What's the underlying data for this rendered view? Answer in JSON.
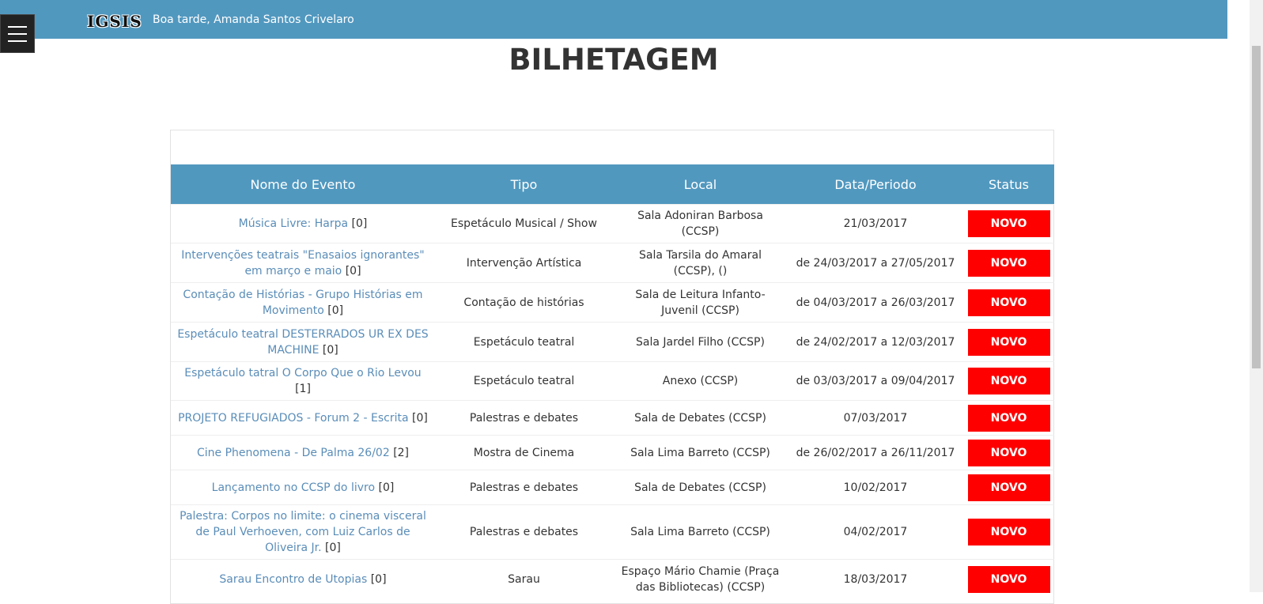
{
  "header": {
    "logo": "IGSIS",
    "greeting": "Boa tarde, Amanda Santos Crivelaro"
  },
  "page": {
    "title": "BILHETAGEM"
  },
  "table": {
    "columns": [
      "Nome do Evento",
      "Tipo",
      "Local",
      "Data/Periodo",
      "Status"
    ],
    "rows": [
      {
        "name": "Música Livre: Harpa",
        "count": "[0]",
        "tipo": "Espetáculo Musical / Show",
        "local": "Sala Adoniran Barbosa (CCSP)",
        "data": "21/03/2017",
        "status": "NOVO"
      },
      {
        "name": "Intervenções teatrais \"Enasaios ignorantes\" em março e maio",
        "count": "[0]",
        "tipo": "Intervenção Artística",
        "local": "Sala Tarsila do Amaral (CCSP), ()",
        "data": "de 24/03/2017 a 27/05/2017",
        "status": "NOVO"
      },
      {
        "name": "Contação de Histórias - Grupo Histórias em Movimento",
        "count": "[0]",
        "tipo": "Contação de histórias",
        "local": "Sala de Leitura Infanto-Juvenil (CCSP)",
        "data": "de 04/03/2017 a 26/03/2017",
        "status": "NOVO"
      },
      {
        "name": "Espetáculo teatral DESTERRADOS UR EX DES MACHINE",
        "count": "[0]",
        "tipo": "Espetáculo teatral",
        "local": "Sala Jardel Filho (CCSP)",
        "data": "de 24/02/2017 a 12/03/2017",
        "status": "NOVO"
      },
      {
        "name": "Espetáculo tatral O Corpo Que o Rio Levou",
        "count": "[1]",
        "tipo": "Espetáculo teatral",
        "local": "Anexo (CCSP)",
        "data": "de 03/03/2017 a 09/04/2017",
        "status": "NOVO"
      },
      {
        "name": "PROJETO REFUGIADOS - Forum 2 - Escrita",
        "count": "[0]",
        "tipo": "Palestras e debates",
        "local": "Sala de Debates (CCSP)",
        "data": "07/03/2017",
        "status": "NOVO"
      },
      {
        "name": "Cine Phenomena - De Palma 26/02",
        "count": "[2]",
        "tipo": "Mostra de Cinema",
        "local": "Sala Lima Barreto (CCSP)",
        "data": "de 26/02/2017 a 26/11/2017",
        "status": "NOVO"
      },
      {
        "name": "Lançamento no CCSP do livro",
        "count": "[0]",
        "tipo": "Palestras e debates",
        "local": "Sala de Debates (CCSP)",
        "data": "10/02/2017",
        "status": "NOVO"
      },
      {
        "name": "Palestra: Corpos no limite: o cinema visceral de Paul Verhoeven, com Luiz Carlos de Oliveira Jr.",
        "count": "[0]",
        "tipo": "Palestras e debates",
        "local": "Sala Lima Barreto (CCSP)",
        "data": "04/02/2017",
        "status": "NOVO"
      },
      {
        "name": "Sarau Encontro de Utopias",
        "count": "[0]",
        "tipo": "Sarau",
        "local": "Espaço Mário Chamie (Praça das Bibliotecas) (CCSP)",
        "data": "18/03/2017",
        "status": "NOVO"
      }
    ]
  },
  "colors": {
    "header_bg": "#5198bf",
    "status_badge": "#ff0000",
    "link": "#5a8db8"
  },
  "icons": {
    "menu": "hamburger-menu-icon"
  }
}
